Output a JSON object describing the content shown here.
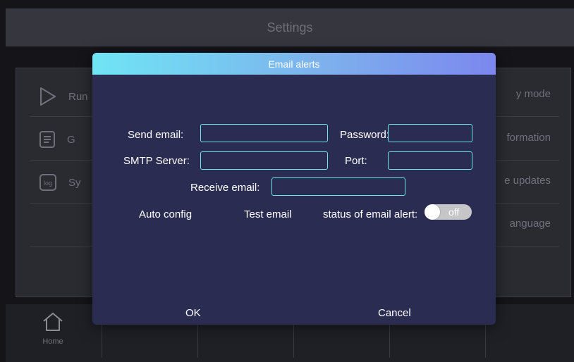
{
  "app": {
    "title": "Settings"
  },
  "background_menu": {
    "rows": [
      {
        "left_label": "Run",
        "left_icon": "play-icon",
        "right_label": "y mode"
      },
      {
        "left_label": "G",
        "left_icon": "document-icon",
        "right_label": "formation"
      },
      {
        "left_label": "Sy",
        "left_icon": "log-icon",
        "icon_text": "log",
        "right_label": "e updates"
      },
      {
        "left_label": "",
        "right_label": "anguage"
      }
    ]
  },
  "bottom_nav": {
    "home_label": "Home",
    "home_icon": "home-icon"
  },
  "dialog": {
    "title": "Email alerts",
    "send_email_label": "Send email:",
    "send_email_value": "",
    "password_label": "Password:",
    "password_value": "",
    "smtp_server_label": "SMTP Server:",
    "smtp_server_value": "",
    "port_label": "Port:",
    "port_value": "",
    "receive_email_label": "Receive email:",
    "receive_email_value": "",
    "auto_config_label": "Auto config",
    "test_email_label": "Test email",
    "status_label": "status of email alert:",
    "status_toggle_text": "off",
    "ok_label": "OK",
    "cancel_label": "Cancel"
  },
  "colors": {
    "accent_cyan": "#6ee6ec",
    "dialog_bg": "#2a2d51",
    "toggle_off": "#c6c6c8"
  }
}
